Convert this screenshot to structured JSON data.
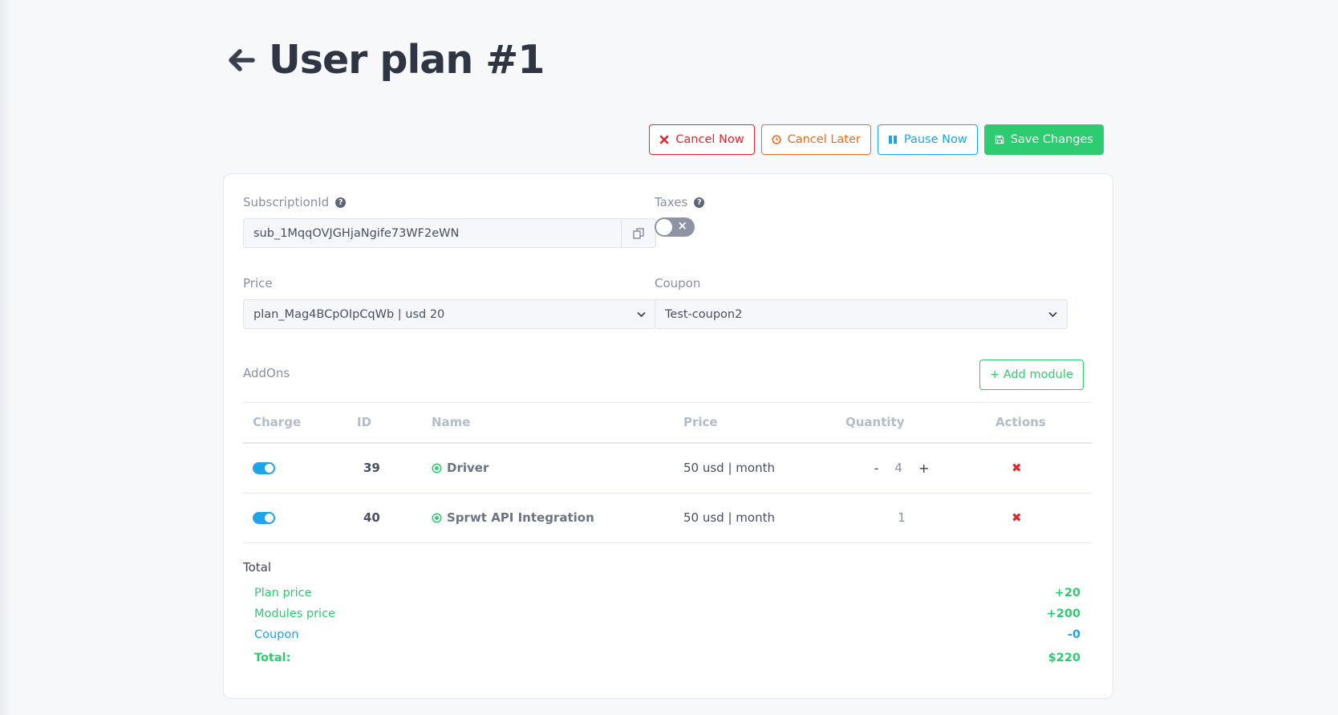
{
  "page": {
    "title": "User plan #1"
  },
  "toolbar": {
    "cancel_now": "Cancel Now",
    "cancel_later": "Cancel Later",
    "pause_now": "Pause Now",
    "save_changes": "Save Changes"
  },
  "form": {
    "subscription_label": "SubscriptionId",
    "subscription_value": "sub_1MqqOVJGHjaNgife73WF2eWN",
    "taxes_label": "Taxes",
    "taxes_enabled": false,
    "price_label": "Price",
    "price_value": "plan_Mag4BCpOIpCqWb | usd 20",
    "coupon_label": "Coupon",
    "coupon_value": "Test-coupon2"
  },
  "addons": {
    "label": "AddOns",
    "add_button": "+ Add module",
    "columns": [
      "Charge",
      "ID",
      "Name",
      "Price",
      "Quantity",
      "Actions"
    ],
    "rows": [
      {
        "charge": true,
        "id": "39",
        "name": "Driver",
        "price": "50 usd | month",
        "quantity": "4",
        "editable_qty": true
      },
      {
        "charge": true,
        "id": "40",
        "name": "Sprwt API Integration",
        "price": "50 usd | month",
        "quantity": "1",
        "editable_qty": false
      }
    ]
  },
  "totals": {
    "title": "Total",
    "plan_price_label": "Plan price",
    "plan_price_value": "+20",
    "modules_price_label": "Modules price",
    "modules_price_value": "+200",
    "coupon_label": "Coupon",
    "coupon_value": "-0",
    "total_label": "Total:",
    "total_value": "$220"
  },
  "colors": {
    "danger": "#e4262e",
    "warning": "#ef6c1e",
    "info": "#1ea5e9",
    "success": "#2ecc71"
  }
}
